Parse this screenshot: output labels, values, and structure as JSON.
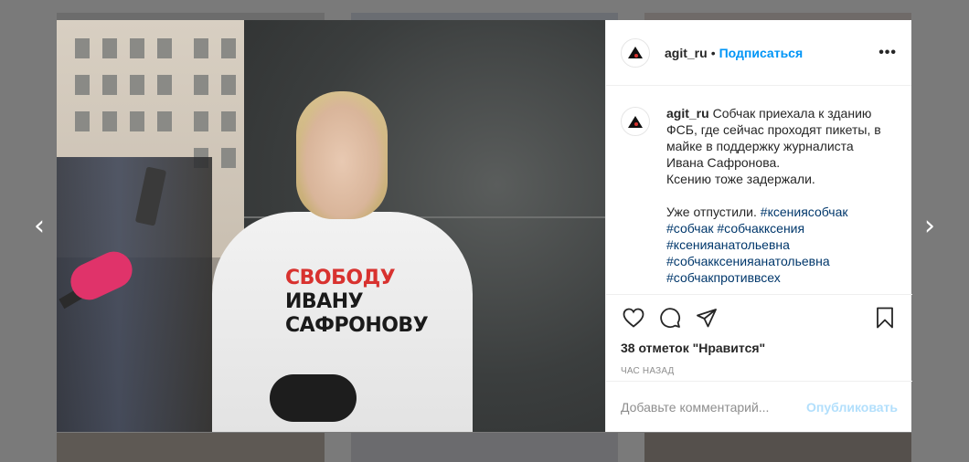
{
  "post": {
    "username": "agit_ru",
    "separator": "•",
    "follow_label": "Подписаться",
    "more_label": "•••",
    "caption_lines": [
      "Собчак приехала к зданию",
      "ФСБ, где сейчас проходят пикеты, в",
      "майке в поддержку журналиста",
      "Ивана Сафронова.",
      "Ксению тоже задержали."
    ],
    "caption_after": "Уже отпустили.",
    "hashtags": [
      "#ксениясобчак",
      "#собчак",
      "#собчакксения",
      "#ксенияанатольевна",
      "#собчакксенияанатольевна",
      "#собчакпротиввсех"
    ],
    "likes_text": "38 отметок \"Нравится\"",
    "time_text": "ЧАС НАЗАД",
    "comment_placeholder": "Добавьте комментарий...",
    "publish_label": "Опубликовать"
  },
  "photo": {
    "shirt_print": [
      "СВОБОДУ",
      "ИВАНУ",
      "САФРОНОВУ"
    ]
  },
  "nav": {
    "prev_label": "‹",
    "next_label": "›"
  },
  "colors": {
    "accent": "#0095f6",
    "hashtag": "#00376b",
    "publish_disabled": "#b2dffc",
    "backdrop": "#7a7a7a"
  }
}
